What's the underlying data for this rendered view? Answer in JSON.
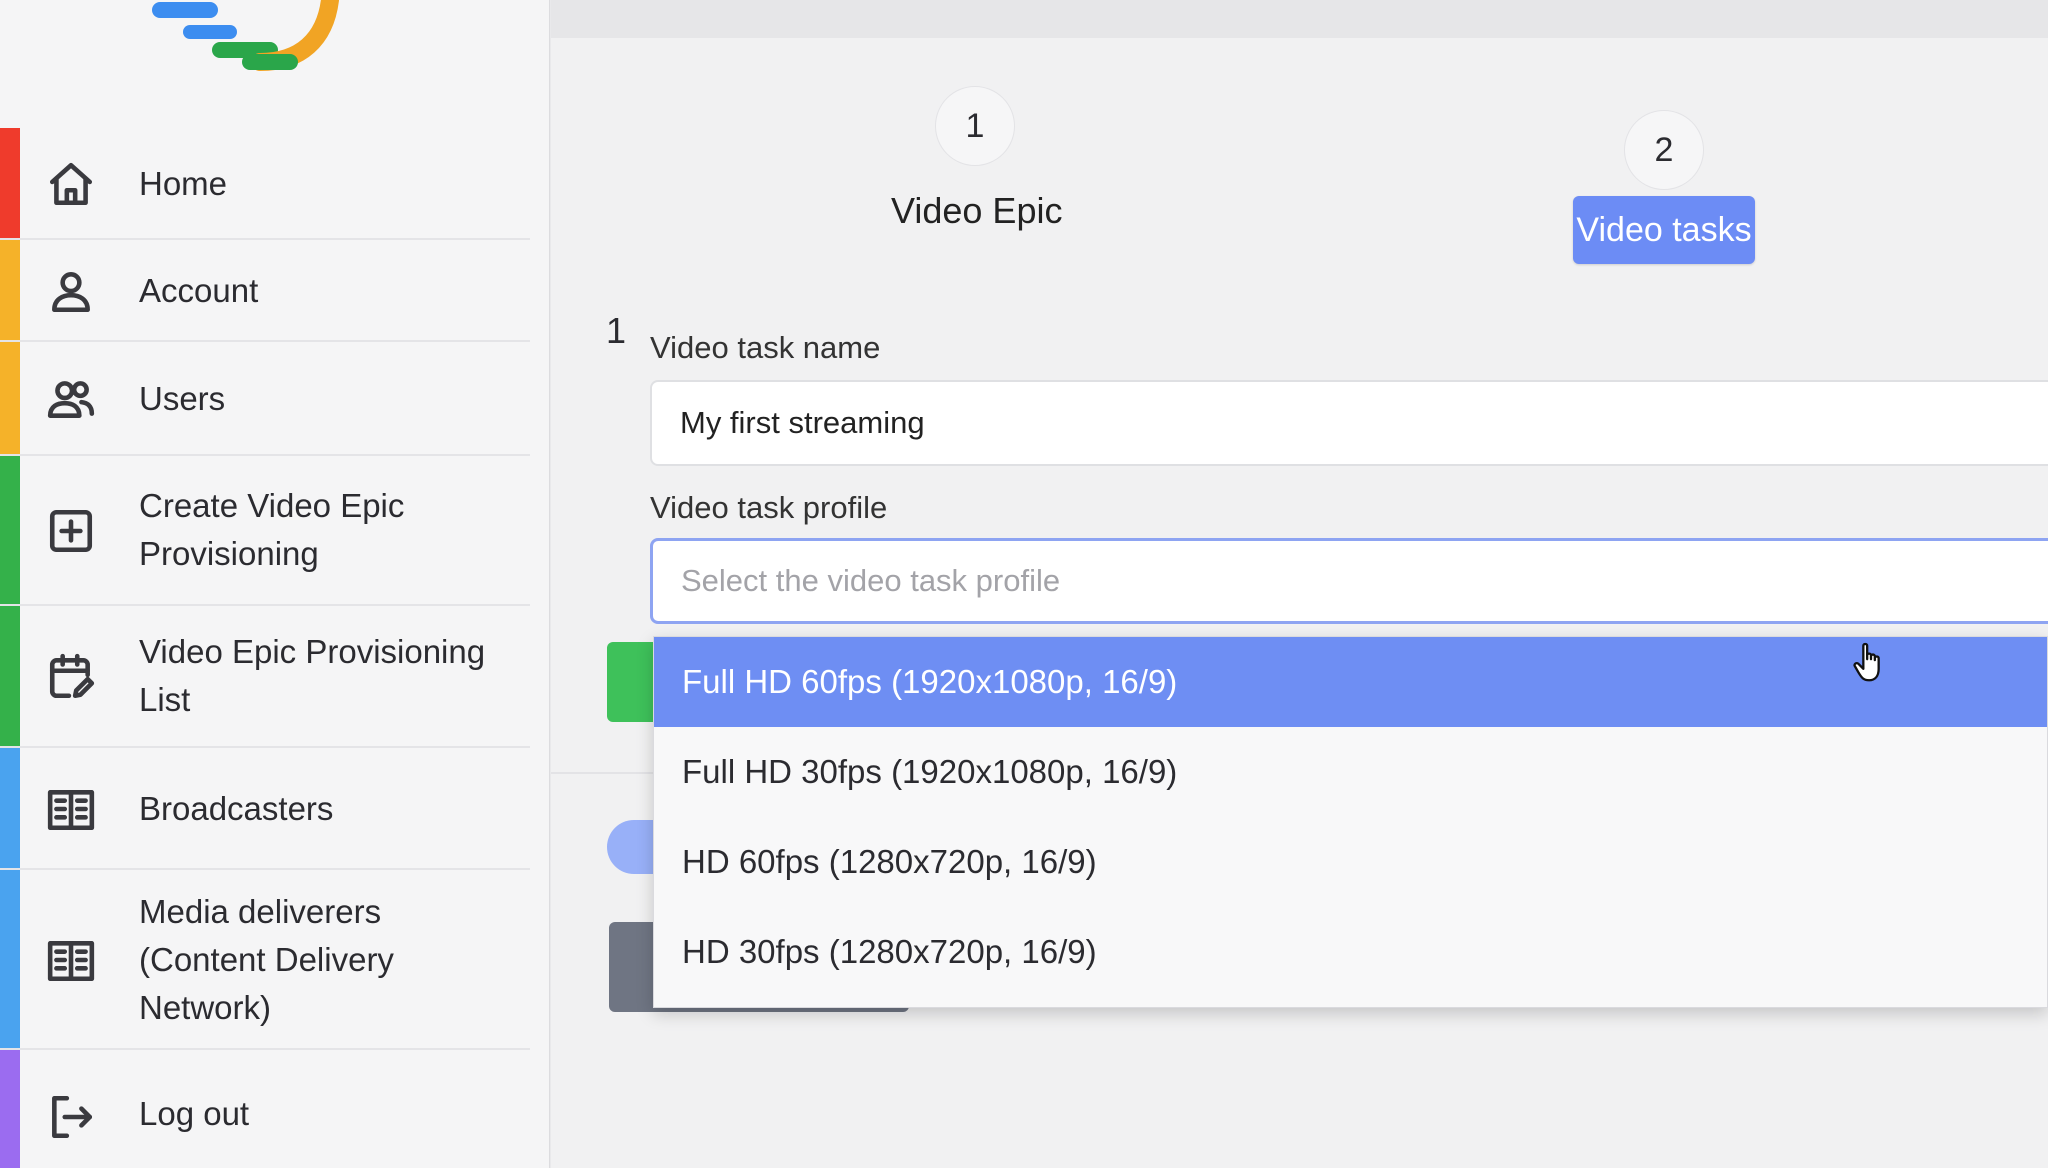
{
  "sidebar": {
    "items": [
      {
        "label": "Home",
        "icon": "home-icon",
        "color": "#ef3b2c"
      },
      {
        "label": "Account",
        "icon": "user-icon",
        "color": "#f5b229"
      },
      {
        "label": "Users",
        "icon": "users-icon",
        "color": "#f5b229"
      },
      {
        "label": "Create Video Epic Provisioning",
        "icon": "plus-square-icon",
        "color": "#34b14a"
      },
      {
        "label": "Video Epic Provisioning List",
        "icon": "calendar-edit-icon",
        "color": "#34b14a"
      },
      {
        "label": "Broadcasters",
        "icon": "building-icon",
        "color": "#4aa3ef"
      },
      {
        "label": "Media deliverers (Content Delivery Network)",
        "icon": "building-icon",
        "color": "#4aa3ef"
      },
      {
        "label": "Log out",
        "icon": "logout-icon",
        "color": "#9b6cf0"
      }
    ]
  },
  "stepper": {
    "step1": {
      "number": "1",
      "title": "Video Epic"
    },
    "step2": {
      "number": "2",
      "title": "Video tasks"
    }
  },
  "form": {
    "index": "1",
    "task_name": {
      "label": "Video task name",
      "value": "My first streaming"
    },
    "task_profile": {
      "label": "Video task profile",
      "placeholder": "Select the video task profile"
    }
  },
  "dropdown": {
    "options": [
      "Full HD 60fps (1920x1080p, 16/9)",
      "Full HD 30fps (1920x1080p, 16/9)",
      "HD 60fps (1280x720p, 16/9)",
      "HD 30fps (1280x720p, 16/9)"
    ],
    "highlighted_index": 0
  },
  "colors": {
    "accent": "#6e8ef3",
    "success": "#3ec15a"
  }
}
